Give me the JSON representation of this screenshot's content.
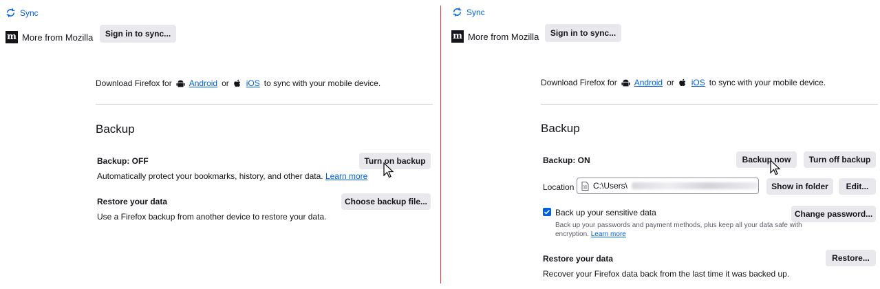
{
  "left": {
    "sync_label": "Sync",
    "more_from_mozilla": "More from Mozilla",
    "sign_in_button": "Sign in to sync...",
    "download": {
      "prefix": "Download Firefox for",
      "android": "Android",
      "or": "or",
      "ios": "iOS",
      "suffix": "to sync with your mobile device."
    },
    "backup_heading": "Backup",
    "backup_status": "Backup: OFF",
    "turn_on_button": "Turn on backup",
    "backup_desc": "Automatically protect your bookmarks, history, and other data.",
    "learn_more": "Learn more",
    "restore_heading": "Restore your data",
    "choose_file_button": "Choose backup file...",
    "restore_desc": "Use a Firefox backup from another device to restore your data."
  },
  "right": {
    "sync_label": "Sync",
    "more_from_mozilla": "More from Mozilla",
    "sign_in_button": "Sign in to sync...",
    "download": {
      "prefix": "Download Firefox for",
      "android": "Android",
      "or": "or",
      "ios": "iOS",
      "suffix": "to sync with your mobile device."
    },
    "backup_heading": "Backup",
    "backup_status": "Backup: ON",
    "backup_now_button": "Backup now",
    "turn_off_button": "Turn off backup",
    "location_label": "Location",
    "location_path": "C:\\Users\\",
    "show_in_folder_button": "Show in folder",
    "edit_button": "Edit...",
    "sensitive_label": "Back up your sensitive data",
    "sensitive_checked": true,
    "change_password_button": "Change password...",
    "sensitive_desc_line1": "Back up your passwords and payment methods, plus keep all your data safe with",
    "sensitive_desc_line2": "encryption.",
    "learn_more": "Learn more",
    "restore_heading": "Restore your data",
    "restore_button": "Restore...",
    "restore_desc": "Recover your Firefox data back from the last time it was backed up."
  },
  "colors": {
    "accent": "#0061e0",
    "button_bg": "#e9e9ed",
    "divider": "#e23a3a"
  },
  "icons": [
    "sync-icon",
    "mozilla-logo-icon",
    "android-icon",
    "apple-icon",
    "file-icon",
    "checkmark-icon",
    "mouse-cursor-icon"
  ]
}
